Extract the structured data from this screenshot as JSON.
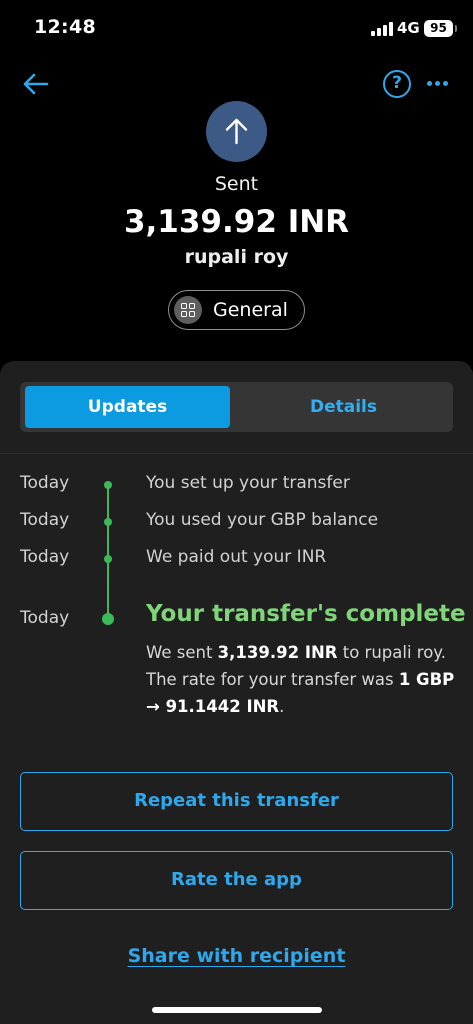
{
  "status_bar": {
    "time": "12:48",
    "network": "4G",
    "battery": "95"
  },
  "nav": {
    "back_icon": "arrow-left-icon",
    "help_label": "?",
    "more_icon": "more-horizontal-icon",
    "accent_color": "#2ea8ec"
  },
  "header": {
    "direction_icon": "arrow-up-icon",
    "status": "Sent",
    "amount": "3,139.92 INR",
    "recipient": "rupali roy",
    "category": "General",
    "category_icon": "grid-icon"
  },
  "tabs": {
    "items": [
      "Updates",
      "Details"
    ],
    "selected": "Updates"
  },
  "timeline": {
    "events": [
      {
        "day": "Today",
        "text": "You set up your transfer"
      },
      {
        "day": "Today",
        "text": "You used your GBP balance"
      },
      {
        "day": "Today",
        "text": "We paid out your INR"
      }
    ],
    "final": {
      "day": "Today",
      "title": "Your transfer's complete",
      "detail": {
        "pre": "We sent ",
        "amount": "3,139.92 INR",
        "mid": " to rupali roy. The rate for your transfer was ",
        "rate": "1 GBP → 91.1442 INR",
        "post": "."
      }
    },
    "line_color": "#3cba5a"
  },
  "actions": {
    "repeat_label": "Repeat this transfer",
    "rate_label": "Rate the app",
    "share_label": "Share with recipient"
  }
}
